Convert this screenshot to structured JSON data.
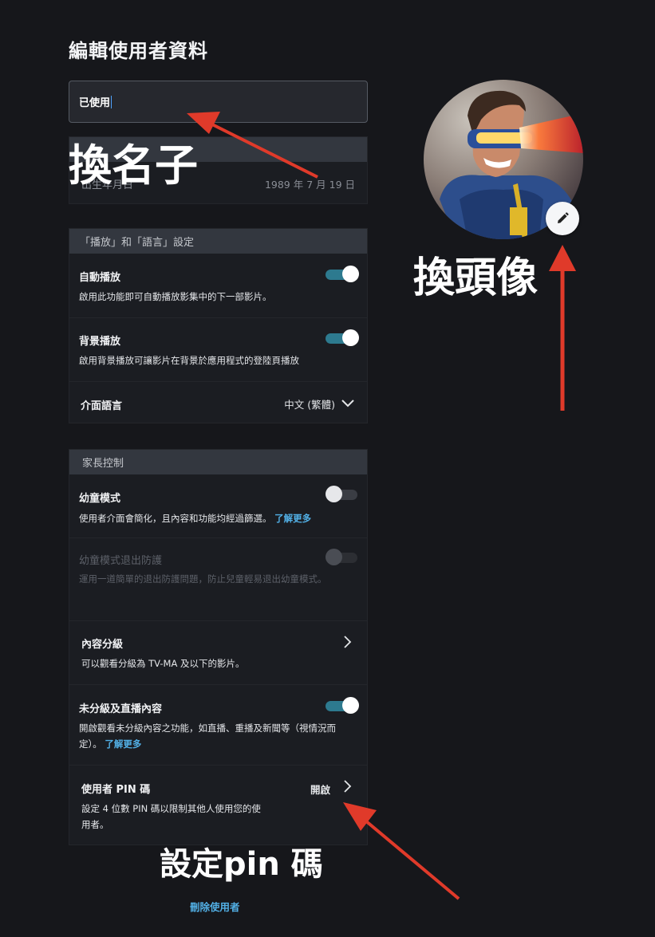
{
  "page": {
    "title": "編輯使用者資料",
    "name_value": "已使用"
  },
  "birth_panel": {
    "header": "",
    "birth_label": "出生年月日",
    "birth_value": "1989 年 7 月 19 日"
  },
  "playback_panel": {
    "header": "「播放」和「語言」設定",
    "autoplay": {
      "title": "自動播放",
      "desc": "啟用此功能即可自動播放影集中的下一部影片。",
      "enabled": true
    },
    "background_play": {
      "title": "背景播放",
      "desc": "啟用背景播放可讓影片在背景於應用程式的登陸頁播放",
      "enabled": true
    },
    "ui_language": {
      "title": "介面語言",
      "value": "中文 (繁體)"
    }
  },
  "parental_panel": {
    "header": "家長控制",
    "kids_mode": {
      "title": "幼童模式",
      "desc": "使用者介面會簡化，且內容和功能均經過篩選。",
      "link": "了解更多",
      "enabled": false
    },
    "kids_exit": {
      "title": "幼童模式退出防護",
      "desc": "運用一道簡單的退出防護問題，防止兒童輕易退出幼童模式。",
      "enabled": false
    },
    "content_rating": {
      "title": "內容分級",
      "desc": "可以觀看分級為 TV-MA 及以下的影片。"
    },
    "unrated": {
      "title": "未分級及直播內容",
      "desc": "開啟觀看未分級內容之功能，如直播、重播及新聞等（視情況而定）。",
      "link": "了解更多",
      "enabled": true
    },
    "pin": {
      "title": "使用者 PIN 碼",
      "value": "開啟",
      "desc": "設定 4 位數 PIN 碼以限制其他人使用您的使用者。"
    }
  },
  "annotations": {
    "rename": "換名子",
    "change_avatar": "換頭像",
    "set_pin": "設定pin 碼",
    "arrow_color": "#e03a2a"
  },
  "footer": {
    "delete_label": "刪除使用者"
  },
  "colors": {
    "accent": "#52b0e6",
    "toggle_on": "#2d7a8f",
    "background": "#16171b"
  },
  "icons": {
    "edit": "pencil-icon",
    "dropdown": "chevron-down-icon",
    "row_arrow": "chevron-right-icon"
  }
}
